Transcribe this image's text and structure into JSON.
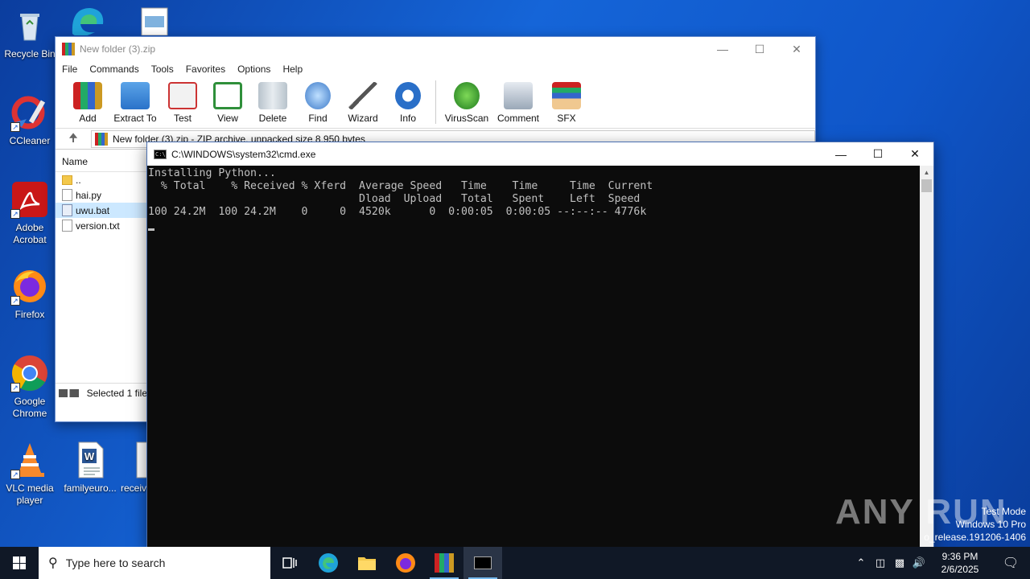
{
  "desktop": {
    "icons": [
      {
        "label": "Recycle Bin"
      },
      {
        "label": "CCleaner"
      },
      {
        "label": "Adobe Acrobat"
      },
      {
        "label": "Firefox"
      },
      {
        "label": "Google Chrome"
      },
      {
        "label": "VLC media player"
      },
      {
        "label": "familyeuro..."
      },
      {
        "label": "receiv"
      }
    ]
  },
  "winrar": {
    "title": "New folder (3).zip",
    "menu": [
      "File",
      "Commands",
      "Tools",
      "Favorites",
      "Options",
      "Help"
    ],
    "toolbar": [
      {
        "label": "Add",
        "icon": "add-archive-icon"
      },
      {
        "label": "Extract To",
        "icon": "extract-folder-icon"
      },
      {
        "label": "Test",
        "icon": "test-clipboard-icon"
      },
      {
        "label": "View",
        "icon": "view-book-icon"
      },
      {
        "label": "Delete",
        "icon": "trash-icon"
      },
      {
        "label": "Find",
        "icon": "magnifier-icon"
      },
      {
        "label": "Wizard",
        "icon": "magic-wand-icon"
      },
      {
        "label": "Info",
        "icon": "info-icon"
      },
      {
        "label": "VirusScan",
        "icon": "bug-scan-icon"
      },
      {
        "label": "Comment",
        "icon": "comment-icon"
      },
      {
        "label": "SFX",
        "icon": "sfx-box-icon"
      }
    ],
    "path": "New folder (3).zip - ZIP archive, unpacked size 8,950 bytes",
    "column_name": "Name",
    "files": [
      {
        "name": "..",
        "type": "folder"
      },
      {
        "name": "hai.py",
        "type": "file"
      },
      {
        "name": "uwu.bat",
        "type": "bat",
        "selected": true
      },
      {
        "name": "version.txt",
        "type": "file"
      }
    ],
    "status": "Selected 1 file"
  },
  "cmd": {
    "title": "C:\\WINDOWS\\system32\\cmd.exe",
    "lines": [
      "Installing Python...",
      "  % Total    % Received % Xferd  Average Speed   Time    Time     Time  Current",
      "                                 Dload  Upload   Total   Spent    Left  Speed",
      "100 24.2M  100 24.2M    0     0  4520k      0  0:00:05  0:00:05 --:--:-- 4776k"
    ]
  },
  "watermark": {
    "brand": "ANY RUN",
    "line1": "Test Mode",
    "line2": "Windows 10 Pro",
    "line3": "o_release.191206-1406"
  },
  "taskbar": {
    "search_placeholder": "Type here to search",
    "time": "9:36 PM",
    "date": "2/6/2025"
  }
}
